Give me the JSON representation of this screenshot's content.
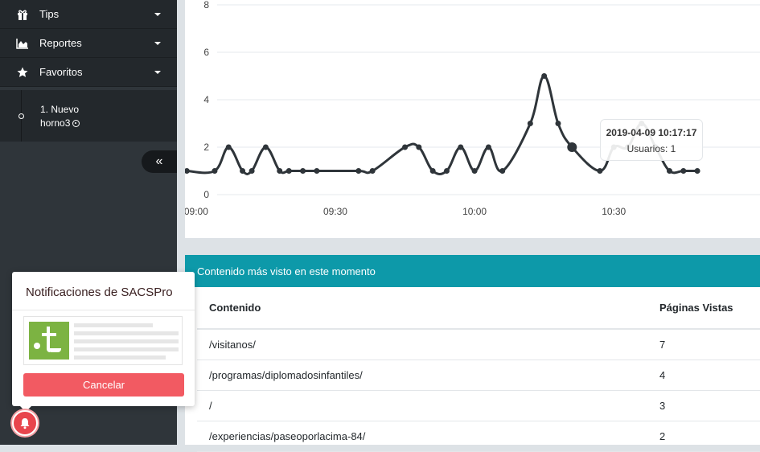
{
  "sidebar": {
    "items": [
      {
        "label": "Tips",
        "icon": "gift-icon"
      },
      {
        "label": "Reportes",
        "icon": "area-chart-icon"
      },
      {
        "label": "Favoritos",
        "icon": "star-icon"
      }
    ],
    "favorite": {
      "line1": "1. Nuevo",
      "line2": "horno3"
    },
    "collapse_label": "«"
  },
  "chart_data": {
    "type": "line",
    "title": "",
    "xlabel": "",
    "ylabel": "",
    "ylim": [
      0,
      8
    ],
    "yticks": [
      0,
      2,
      4,
      6,
      8
    ],
    "xtick_labels": [
      "09:00",
      "09:30",
      "10:00",
      "10:30"
    ],
    "xlim_minutes": [
      537.6,
      661.5
    ],
    "x_minutes": [
      538,
      544,
      547,
      550,
      552,
      555,
      558,
      560,
      563,
      566,
      575,
      578,
      585,
      588,
      591,
      594,
      597,
      600,
      603,
      606,
      612,
      615,
      618,
      621,
      627,
      630,
      633,
      636,
      639,
      642,
      645,
      648
    ],
    "y": [
      1,
      1,
      2,
      1,
      1,
      2,
      1,
      1,
      1,
      1,
      1,
      1,
      2,
      2,
      1,
      1,
      2,
      1,
      2,
      1,
      3,
      5,
      3,
      2,
      1,
      2,
      2,
      3,
      2,
      1,
      1,
      1
    ],
    "color": "#2f353a",
    "grid": true,
    "tooltip": {
      "date": "2019-04-09 10:17:17",
      "value": "Usuarios: 1"
    }
  },
  "table": {
    "title": "Contenido más visto en este momento",
    "headers": [
      "Contenido",
      "Páginas Vistas"
    ],
    "rows": [
      [
        "/visitanos/",
        "7"
      ],
      [
        "/programas/diplomadosinfantiles/",
        "4"
      ],
      [
        "/",
        "3"
      ],
      [
        "/experiencias/paseoporlacima-84/",
        "2"
      ]
    ]
  },
  "notification": {
    "title": "Notificaciones de SACSPro",
    "cancel_label": "Cancelar"
  },
  "colors": {
    "sidebar": "#2f353a",
    "accent": "#0d99a9",
    "danger": "#f25a62"
  }
}
